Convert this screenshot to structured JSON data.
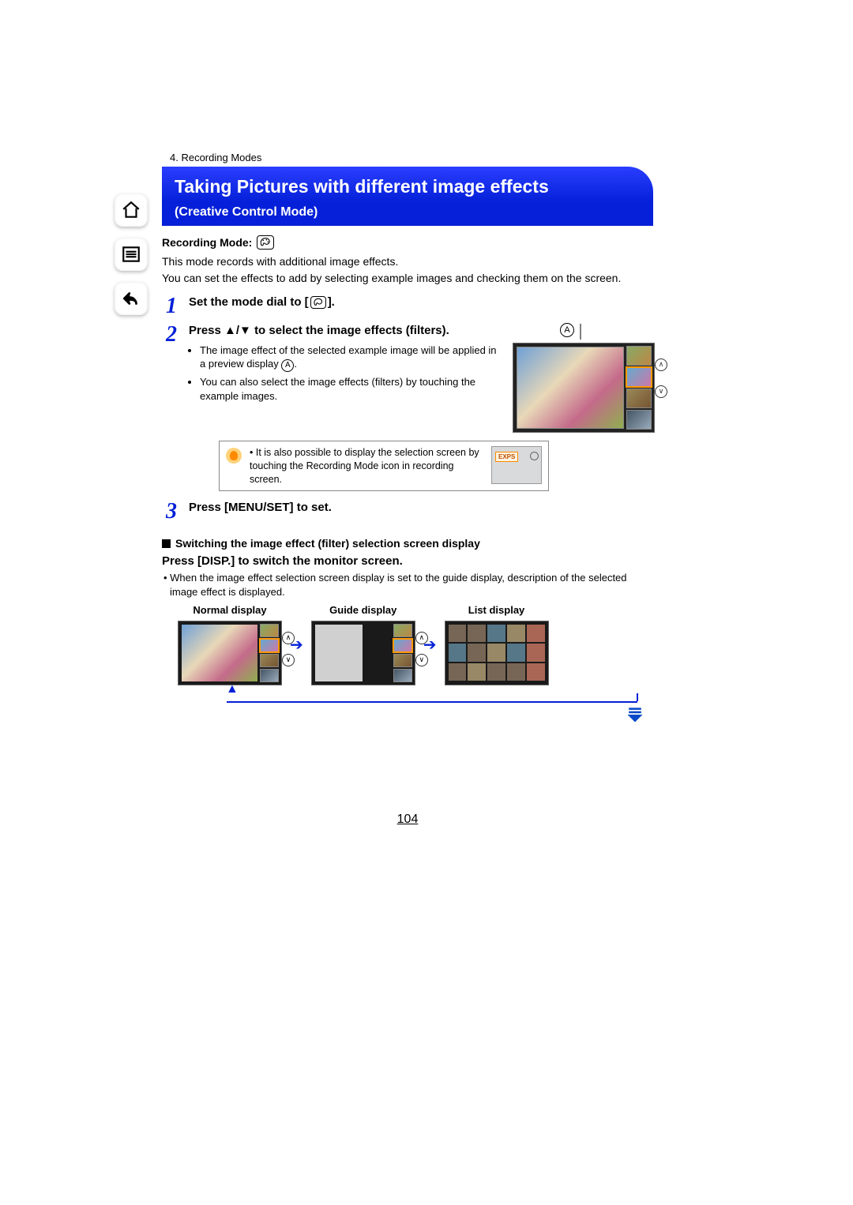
{
  "breadcrumb": "4. Recording Modes",
  "title": "Taking Pictures with different image effects",
  "subtitle": "(Creative Control Mode)",
  "recording_mode_label": "Recording Mode:",
  "intro": {
    "line1": "This mode records with additional image effects.",
    "line2": "You can set the effects to add by selecting example images and checking them on the screen."
  },
  "steps": {
    "s1": {
      "num": "1",
      "title_a": "Set the mode dial to [",
      "title_b": "]."
    },
    "s2": {
      "num": "2",
      "title": "Press ▲/▼ to select the image effects (filters).",
      "callout_letter": "A",
      "bullet1_a": "The image effect of the selected example image will be applied in a preview display ",
      "bullet1_b": ".",
      "bullet2": "You can also select the image effects (filters) by touching the example images."
    },
    "tip": {
      "text": "It is also possible to display the selection screen by touching the Recording Mode icon in recording screen.",
      "tag": "EXPS"
    },
    "s3": {
      "num": "3",
      "title": "Press [MENU/SET] to set."
    }
  },
  "switching_heading": "Switching the image effect (filter) selection screen display",
  "disp_heading": "Press [DISP.] to switch the monitor screen.",
  "disp_note": "• When the image effect selection screen display is set to the guide display, description of the selected image effect is displayed.",
  "displays": {
    "normal": "Normal display",
    "guide": "Guide display",
    "list": "List display"
  },
  "page_number": "104"
}
